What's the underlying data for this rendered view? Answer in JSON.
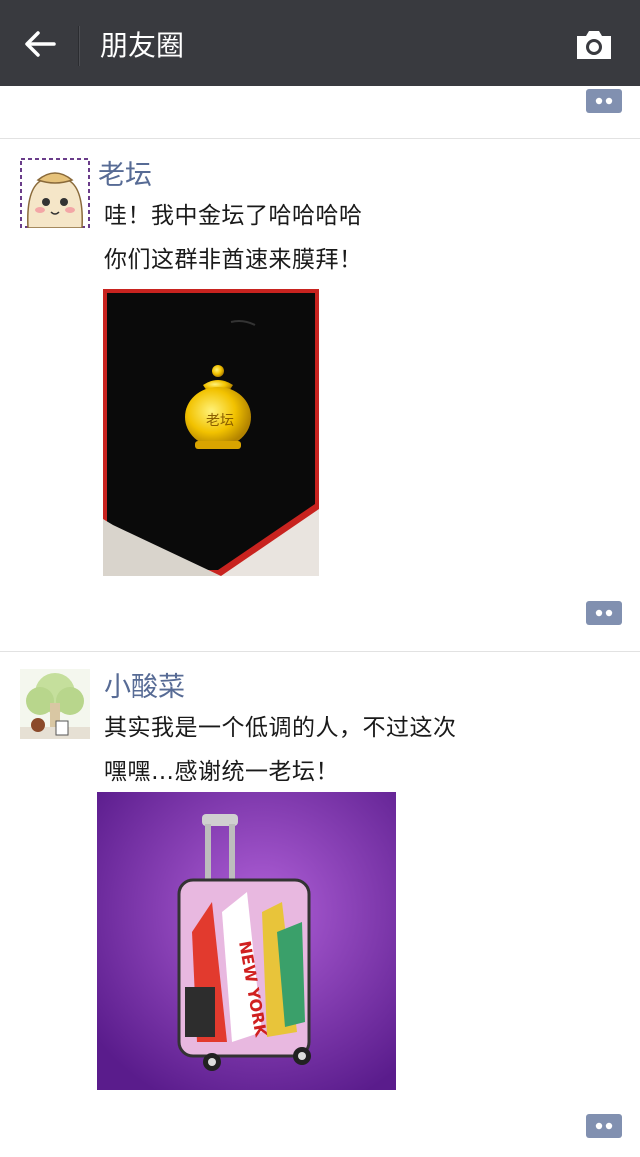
{
  "header": {
    "title": "朋友圈",
    "back_icon": "arrow-left-icon",
    "camera_icon": "camera-icon",
    "bg_color": "#393a3f"
  },
  "posts": [
    {
      "name": "老坛",
      "lines": [
        "哇！我中金坛了哈哈哈哈",
        "你们这群非酋速来膜拜！"
      ],
      "photo": {
        "stamp_text": "老坛"
      }
    },
    {
      "name": "小酸菜",
      "lines": [
        "其实我是一个低调的人，不过这次",
        "嘿嘿…感谢统一老坛！"
      ],
      "photo": {
        "luggage_text": "NEW YORK"
      }
    }
  ],
  "colors": {
    "name": "#576b95",
    "comment_btn": "#8190b0"
  }
}
